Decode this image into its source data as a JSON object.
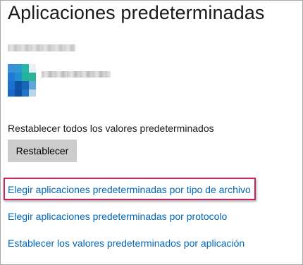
{
  "page": {
    "title": "Aplicaciones predeterminadas"
  },
  "default_app": {
    "icon": "app-tile-icon"
  },
  "reset": {
    "label": "Restablecer todos los valores predeterminados",
    "button_label": "Restablecer"
  },
  "links": [
    {
      "label": "Elegir aplicaciones predeterminadas por tipo de archivo",
      "highlighted": true
    },
    {
      "label": "Elegir aplicaciones predeterminadas por protocolo",
      "highlighted": false
    },
    {
      "label": "Establecer los valores predeterminados por aplicación",
      "highlighted": false
    }
  ],
  "colors": {
    "link": "#0067b8",
    "highlight_border": "#c4235b",
    "button_bg": "#cccccc"
  }
}
